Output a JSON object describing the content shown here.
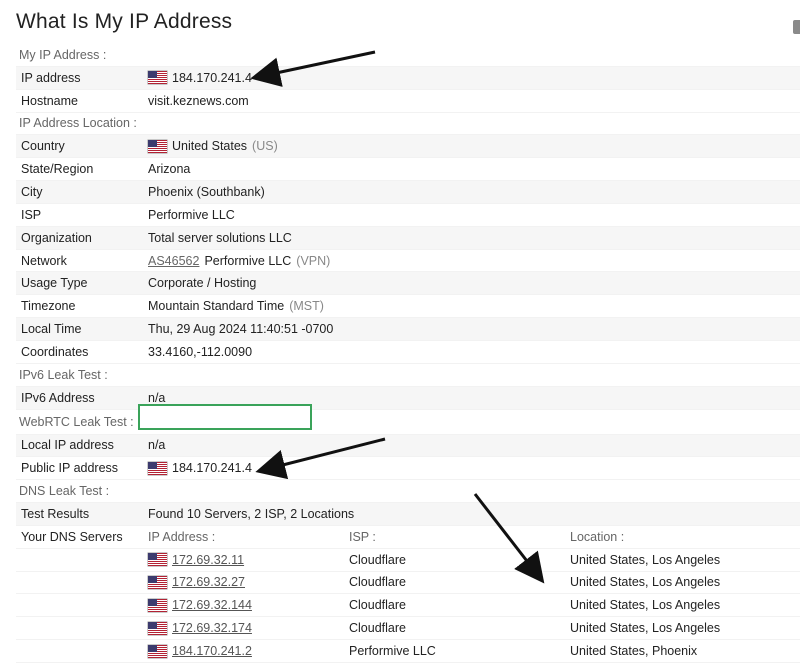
{
  "page": {
    "title": "What Is My IP Address"
  },
  "sections": {
    "my_ip": "My IP Address :",
    "location": "IP Address Location :",
    "ipv6": "IPv6 Leak Test :",
    "webrtc": "WebRTC Leak Test :",
    "dns": "DNS Leak Test :"
  },
  "my_ip": {
    "ip_label": "IP address",
    "ip_value": "184.170.241.4",
    "hostname_label": "Hostname",
    "hostname_value": "visit.keznews.com"
  },
  "location": {
    "country_label": "Country",
    "country_value": "United States",
    "country_code": "(US)",
    "state_label": "State/Region",
    "state_value": "Arizona",
    "city_label": "City",
    "city_value": "Phoenix (Southbank)",
    "isp_label": "ISP",
    "isp_value": "Performive LLC",
    "org_label": "Organization",
    "org_value": "Total server solutions LLC",
    "network_label": "Network",
    "network_asn": "AS46562",
    "network_name": "Performive LLC",
    "network_type": "(VPN)",
    "usage_label": "Usage Type",
    "usage_value": "Corporate / Hosting",
    "tz_label": "Timezone",
    "tz_value": "Mountain Standard Time",
    "tz_abbr": "(MST)",
    "local_time_label": "Local Time",
    "local_time_value": "Thu, 29 Aug 2024 11:40:51 -0700",
    "coords_label": "Coordinates",
    "coords_value": "33.4160,-112.0090"
  },
  "ipv6": {
    "address_label": "IPv6 Address",
    "address_value": "n/a"
  },
  "webrtc": {
    "local_label": "Local IP address",
    "local_value": "n/a",
    "public_label": "Public IP address",
    "public_value": "184.170.241.4"
  },
  "dns": {
    "results_label": "Test Results",
    "results_value": "Found 10 Servers, 2 ISP, 2 Locations",
    "servers_label": "Your DNS Servers",
    "col_ip": "IP Address :",
    "col_isp": "ISP :",
    "col_location": "Location :",
    "servers": [
      {
        "ip": "172.69.32.11",
        "isp": "Cloudflare",
        "location": "United States, Los Angeles"
      },
      {
        "ip": "172.69.32.27",
        "isp": "Cloudflare",
        "location": "United States, Los Angeles"
      },
      {
        "ip": "172.69.32.144",
        "isp": "Cloudflare",
        "location": "United States, Los Angeles"
      },
      {
        "ip": "172.69.32.174",
        "isp": "Cloudflare",
        "location": "United States, Los Angeles"
      },
      {
        "ip": "184.170.241.2",
        "isp": "Performive LLC",
        "location": "United States, Phoenix"
      }
    ]
  },
  "icons": {
    "flag": "us-flag-icon",
    "arrow": "arrow-annotation-icon"
  },
  "colors": {
    "webrtc_border": "#3aa35a",
    "row_shade": "#f6f6f6",
    "arrow": "#111111"
  }
}
